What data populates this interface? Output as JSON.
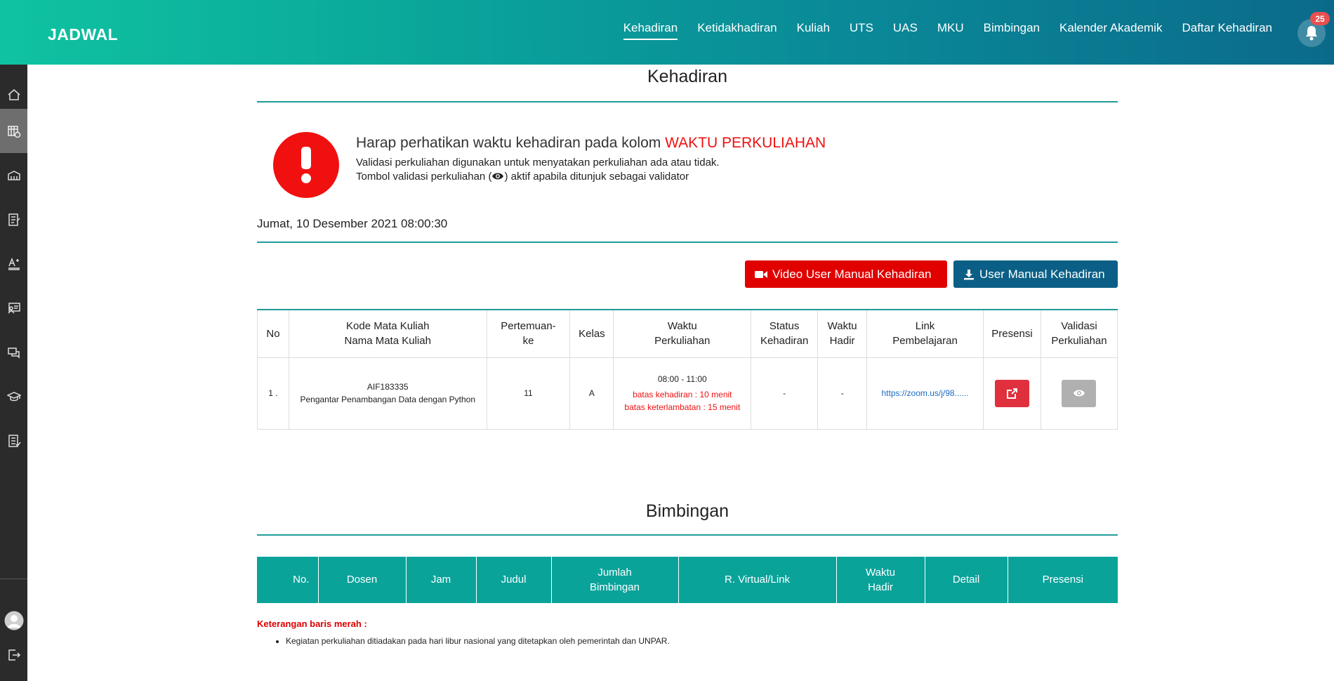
{
  "header": {
    "brand": "JADWAL",
    "nav": [
      "Kehadiran",
      "Ketidakhadiran",
      "Kuliah",
      "UTS",
      "UAS",
      "MKU",
      "Bimbingan",
      "Kalender Akademik",
      "Daftar Kehadiran"
    ],
    "notification_count": "25"
  },
  "sidebar": {
    "items": [
      "home-icon",
      "schedule-icon",
      "building-icon",
      "document-icon",
      "font-icon",
      "presentation-icon",
      "chat-icon",
      "graduation-cap-icon",
      "list-icon"
    ],
    "bottom": [
      "avatar",
      "logout-icon"
    ]
  },
  "kehadiran": {
    "title": "Kehadiran",
    "notice_prefix": "Harap perhatikan waktu kehadiran pada kolom",
    "notice_highlight": "WAKTU PERKULIAHAN",
    "notice_line1": "Validasi perkuliahan digunakan untuk menyatakan perkuliahan ada atau tidak.",
    "notice_line2a": "Tombol validasi perkuliahan (",
    "notice_line2b": ") aktif apabila ditunjuk sebagai validator",
    "datetime": "Jumat, 10 Desember 2021  08:00:30",
    "btn_video": "Video User Manual Kehadiran",
    "btn_manual": "User Manual Kehadiran",
    "headers": {
      "no": "No",
      "kode_a": "Kode Mata Kuliah",
      "kode_b": "Nama Mata Kuliah",
      "pert_a": "Pertemuan-",
      "pert_b": "ke",
      "kelas": "Kelas",
      "waktu_a": "Waktu",
      "waktu_b": "Perkuliahan",
      "status_a": "Status",
      "status_b": "Kehadiran",
      "hadir_a": "Waktu",
      "hadir_b": "Hadir",
      "link_a": "Link",
      "link_b": "Pembelajaran",
      "presensi": "Presensi",
      "valid_a": "Validasi",
      "valid_b": "Perkuliahan"
    },
    "row": {
      "no": "1 .",
      "kode": "AIF183335",
      "nama": "Pengantar Penambangan Data dengan Python",
      "pertemuan": "11",
      "kelas": "A",
      "waktu": "08:00 - 11:00",
      "batas_kehadiran": "batas kehadiran : 10 menit",
      "batas_keterlambatan": "batas keterlambatan : 15 menit",
      "status": "-",
      "waktu_hadir": "-",
      "link": "https://zoom.us/j/98......"
    }
  },
  "bimbingan": {
    "title": "Bimbingan",
    "headers": {
      "no": "No.",
      "dosen": "Dosen",
      "jam": "Jam",
      "judul": "Judul",
      "jumlah_a": "Jumlah",
      "jumlah_b": "Bimbingan",
      "virtual": "R. Virtual/Link",
      "hadir_a": "Waktu",
      "hadir_b": "Hadir",
      "detail": "Detail",
      "presensi": "Presensi"
    },
    "keterangan_title": "Keterangan baris merah :",
    "keterangan_items": [
      "Kegiatan perkuliahan ditiadakan pada hari libur nasional yang ditetapkan oleh pemerintah dan UNPAR."
    ]
  },
  "colors": {
    "accent": "#1f9c99",
    "danger": "#e00000",
    "primary": "#0b5f86"
  }
}
